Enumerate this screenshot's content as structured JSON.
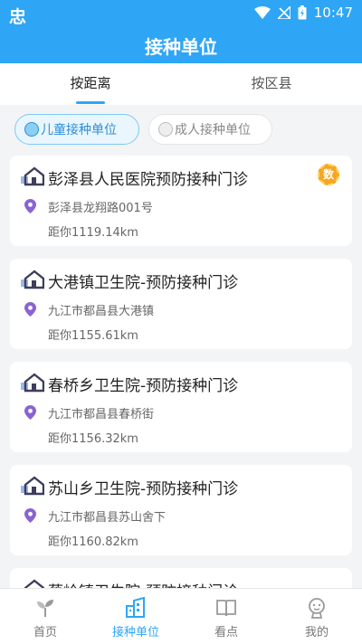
{
  "status_bar": {
    "app_icon": "忠",
    "time": "10:47"
  },
  "header": {
    "title": "接种单位"
  },
  "tabs": [
    {
      "label": "按距离",
      "active": true
    },
    {
      "label": "按区县",
      "active": false
    }
  ],
  "filters": [
    {
      "label": "儿童接种单位",
      "selected": true
    },
    {
      "label": "成人接种单位",
      "selected": false
    }
  ],
  "clinics": [
    {
      "name": "彭泽县人民医院预防接种门诊",
      "address": "彭泽县龙翔路001号",
      "distance": "距你1119.14km",
      "badge": "数"
    },
    {
      "name": "大港镇卫生院-预防接种门诊",
      "address": "九江市都昌县大港镇",
      "distance": "距你1155.61km"
    },
    {
      "name": "春桥乡卫生院-预防接种门诊",
      "address": "九江市都昌县春桥街",
      "distance": "距你1156.32km"
    },
    {
      "name": "苏山乡卫生院-预防接种门诊",
      "address": "九江市都昌县苏山舍下",
      "distance": "距你1160.82km"
    },
    {
      "name": "蔡岭镇卫生院-预防接种门诊"
    }
  ],
  "bottom_nav": [
    {
      "label": "首页",
      "icon": "home-sprout-icon",
      "active": false
    },
    {
      "label": "接种单位",
      "icon": "building-icon",
      "active": true
    },
    {
      "label": "看点",
      "icon": "book-icon",
      "active": false
    },
    {
      "label": "我的",
      "icon": "profile-icon",
      "active": false
    }
  ],
  "colors": {
    "primary": "#2ea6f5",
    "badge": "#f6a623",
    "location_pin": "#8a63d2"
  }
}
